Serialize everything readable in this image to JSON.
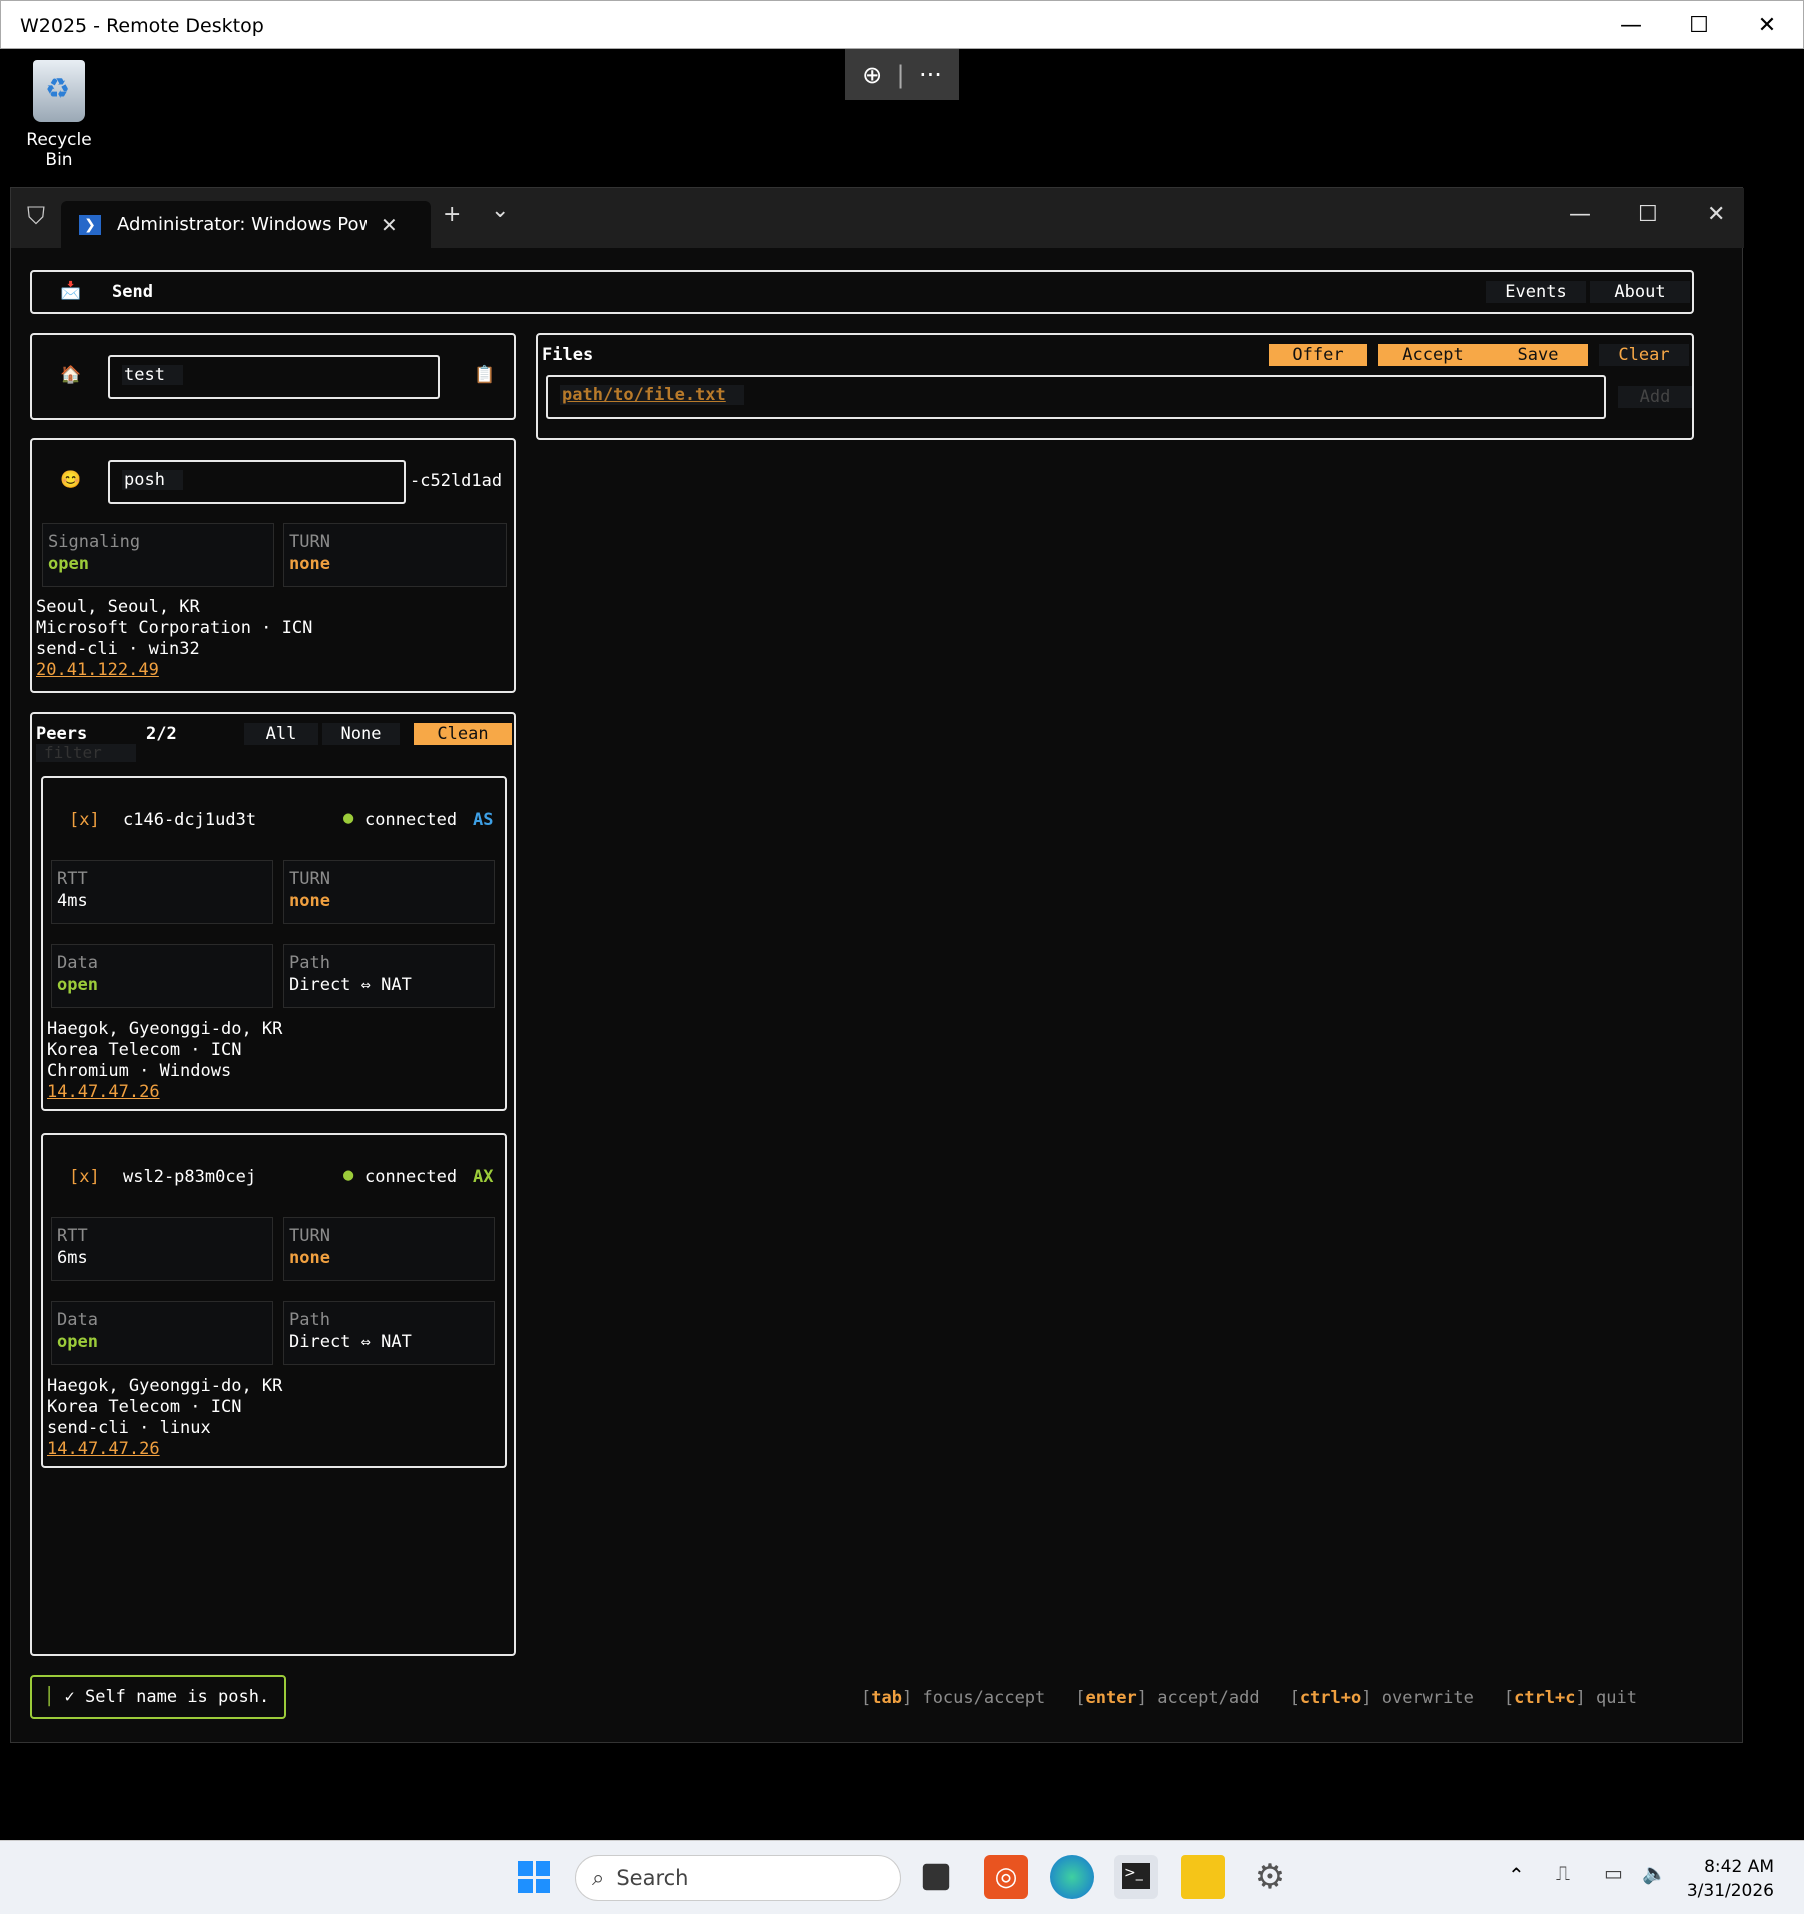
{
  "rdp": {
    "title": "W2025 - Remote Desktop",
    "minimize": "—",
    "maximize": "☐",
    "close": "✕",
    "zoom_icon": "⊕",
    "more_icon": "···"
  },
  "desktop": {
    "recycle_label": "Recycle Bin"
  },
  "terminal": {
    "tab_title": "Administrator: Windows PowerShell",
    "new_tab": "+",
    "dropdown": "⌄",
    "minimize": "—",
    "maximize": "☐",
    "close": "✕"
  },
  "app": {
    "header": {
      "title": "Send",
      "events": "Events",
      "about": "About"
    },
    "room": {
      "value": "test"
    },
    "self": {
      "name": "posh",
      "suffix": "-c52ld1ad",
      "signaling_label": "Signaling",
      "signaling_value": "open",
      "turn_label": "TURN",
      "turn_value": "none",
      "location": "Seoul, Seoul, KR",
      "isp": "Microsoft Corporation · ICN",
      "client": "send-cli · win32",
      "ip": "20.41.122.49"
    },
    "peers": {
      "label": "Peers",
      "count": "2/2",
      "all": "All",
      "none": "None",
      "clean": "Clean",
      "filter_placeholder": "filter",
      "items": [
        {
          "check": "[x]",
          "name": "c146-dcj1ud3t",
          "status": "connected",
          "badge": "AS",
          "rtt_label": "RTT",
          "rtt": "4ms",
          "turn_label": "TURN",
          "turn": "none",
          "data_label": "Data",
          "data": "open",
          "path_label": "Path",
          "path": "Direct ⇔ NAT",
          "location": "Haegok, Gyeonggi-do, KR",
          "isp": "Korea Telecom · ICN",
          "client": "Chromium · Windows",
          "ip": "14.47.47.26"
        },
        {
          "check": "[x]",
          "name": "wsl2-p83m0cej",
          "status": "connected",
          "badge": "AX",
          "rtt_label": "RTT",
          "rtt": "6ms",
          "turn_label": "TURN",
          "turn": "none",
          "data_label": "Data",
          "data": "open",
          "path_label": "Path",
          "path": "Direct ⇔ NAT",
          "location": "Haegok, Gyeonggi-do, KR",
          "isp": "Korea Telecom · ICN",
          "client": "send-cli · linux",
          "ip": "14.47.47.26"
        }
      ]
    },
    "files": {
      "label": "Files",
      "offer": "Offer",
      "accept": "Accept",
      "save": "Save",
      "clear": "Clear",
      "path_placeholder": "path/to/file.txt",
      "add": "Add"
    },
    "status": {
      "message": "✓ Self name is posh."
    },
    "hints": [
      {
        "key": "tab",
        "action": "focus/accept"
      },
      {
        "key": "enter",
        "action": "accept/add"
      },
      {
        "key": "ctrl+o",
        "action": "overwrite"
      },
      {
        "key": "ctrl+c",
        "action": "quit"
      }
    ]
  },
  "taskbar": {
    "search": "Search",
    "time": "8:42 AM",
    "date": "3/31/2026"
  }
}
